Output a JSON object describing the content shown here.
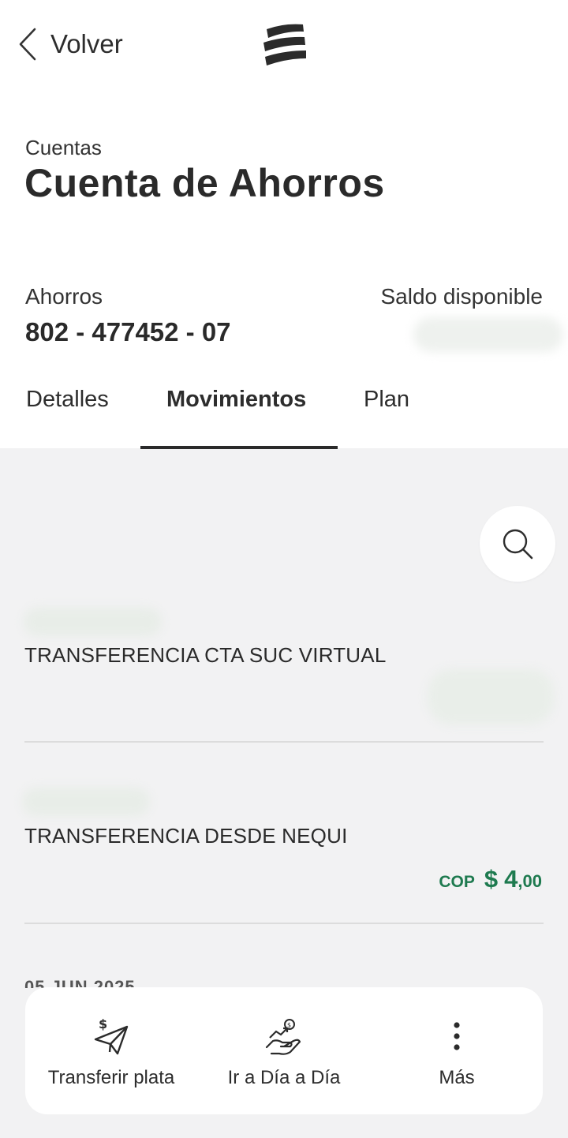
{
  "header": {
    "back_label": "Volver",
    "breadcrumb": "Cuentas",
    "title": "Cuenta de Ahorros"
  },
  "account": {
    "type": "Ahorros",
    "number": "802 - 477452 - 07",
    "balance_label": "Saldo disponible"
  },
  "tabs": [
    {
      "label": "Detalles",
      "active": false
    },
    {
      "label": "Movimientos",
      "active": true
    },
    {
      "label": "Plan",
      "active": false
    }
  ],
  "transactions": [
    {
      "description": "TRANSFERENCIA CTA SUC VIRTUAL"
    },
    {
      "description": "TRANSFERENCIA DESDE NEQUI",
      "currency": "COP",
      "symbol": "$",
      "amount_int": "4",
      "amount_dec": ",00"
    }
  ],
  "next_date_partial": "05 JUN 2025",
  "bottom_actions": [
    {
      "label": "Transferir plata",
      "icon": "send-money-icon"
    },
    {
      "label": "Ir a Día a Día",
      "icon": "hand-money-icon"
    },
    {
      "label": "Más",
      "icon": "more-vertical-icon"
    }
  ],
  "colors": {
    "amount": "#1e7a4f",
    "text": "#2a2a2a",
    "background": "#f2f2f3"
  }
}
